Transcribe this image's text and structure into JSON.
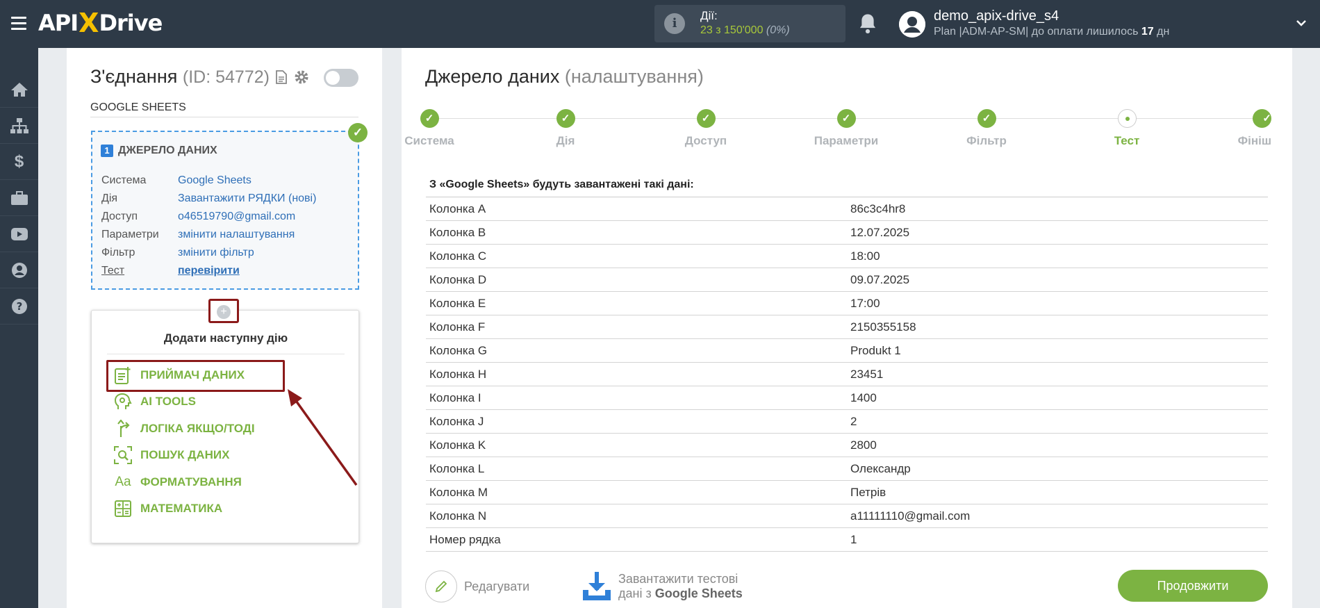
{
  "header": {
    "logo": {
      "left": "API",
      "x": "X",
      "right": "Drive"
    },
    "actions_label": "Дії:",
    "actions_count": "23 з 150'000",
    "actions_percent": "(0%)",
    "user_name": "demo_apix-drive_s4",
    "plan_prefix": "Plan |ADM-AP-SM| до оплати лишилось",
    "plan_days": "17",
    "plan_suffix": "дн"
  },
  "sidebar": {
    "items": [
      "home-icon",
      "sitemap-icon",
      "dollar-icon",
      "briefcase-icon",
      "youtube-icon",
      "user-icon",
      "help-icon"
    ]
  },
  "connection": {
    "title": "З'єднання",
    "id_text": "(ID: 54772)",
    "subtitle": "GOOGLE SHEETS",
    "source": {
      "number": "1",
      "heading": "ДЖЕРЕЛО ДАНИХ",
      "rows": [
        {
          "key": "Система",
          "value": "Google Sheets"
        },
        {
          "key": "Дія",
          "value": "Завантажити РЯДКИ (нові)"
        },
        {
          "key": "Доступ",
          "value": "o46519790@gmail.com"
        },
        {
          "key": "Параметри",
          "value": "змінити налаштування"
        },
        {
          "key": "Фільтр",
          "value": "змінити фільтр"
        },
        {
          "key": "Тест",
          "value": "перевірити"
        }
      ]
    },
    "add_plus": "+",
    "add_title": "Додати наступну дію",
    "add_items": [
      {
        "label": "ПРИЙМАЧ ДАНИХ",
        "icon": "receiver-icon"
      },
      {
        "label": "AI TOOLS",
        "icon": "ai-head-icon"
      },
      {
        "label": "ЛОГІКА ЯКЩО/ТОДІ",
        "icon": "branch-icon"
      },
      {
        "label": "ПОШУК ДАНИХ",
        "icon": "search-data-icon"
      },
      {
        "label": "ФОРМАТУВАННЯ",
        "icon": "format-icon"
      },
      {
        "label": "МАТЕМАТИКА",
        "icon": "math-icon"
      }
    ]
  },
  "main": {
    "title": "Джерело даних",
    "title_sub": "(налаштування)",
    "steps": [
      {
        "label": "Система",
        "state": "done"
      },
      {
        "label": "Дія",
        "state": "done"
      },
      {
        "label": "Доступ",
        "state": "done"
      },
      {
        "label": "Параметри",
        "state": "done"
      },
      {
        "label": "Фільтр",
        "state": "done"
      },
      {
        "label": "Тест",
        "state": "current"
      },
      {
        "label": "Фініш",
        "state": "done"
      }
    ],
    "table_heading": "З «Google Sheets» будуть завантажені такі дані:",
    "rows": [
      {
        "name": "Колонка A",
        "value": "86c3c4hr8"
      },
      {
        "name": "Колонка B",
        "value": "12.07.2025"
      },
      {
        "name": "Колонка C",
        "value": "18:00"
      },
      {
        "name": "Колонка D",
        "value": "09.07.2025"
      },
      {
        "name": "Колонка E",
        "value": "17:00"
      },
      {
        "name": "Колонка F",
        "value": "2150355158"
      },
      {
        "name": "Колонка G",
        "value": "Produkt 1"
      },
      {
        "name": "Колонка H",
        "value": "23451"
      },
      {
        "name": "Колонка I",
        "value": "1400"
      },
      {
        "name": "Колонка J",
        "value": "2"
      },
      {
        "name": "Колонка K",
        "value": "2800"
      },
      {
        "name": "Колонка L",
        "value": "Олександр"
      },
      {
        "name": "Колонка M",
        "value": "Петрів"
      },
      {
        "name": "Колонка N",
        "value": "a11111110@gmail.com"
      },
      {
        "name": "Номер рядка",
        "value": "1"
      }
    ],
    "edit_label": "Редагувати",
    "download_line1": "Завантажити тестові",
    "download_line2_prefix": "дані з",
    "download_line2_bold": "Google Sheets",
    "continue_label": "Продовжити"
  },
  "colors": {
    "topbar": "#2e3a47",
    "accent_green": "#7cb342",
    "link_blue": "#2f6fb7",
    "highlight_red": "#8b1a1a"
  }
}
